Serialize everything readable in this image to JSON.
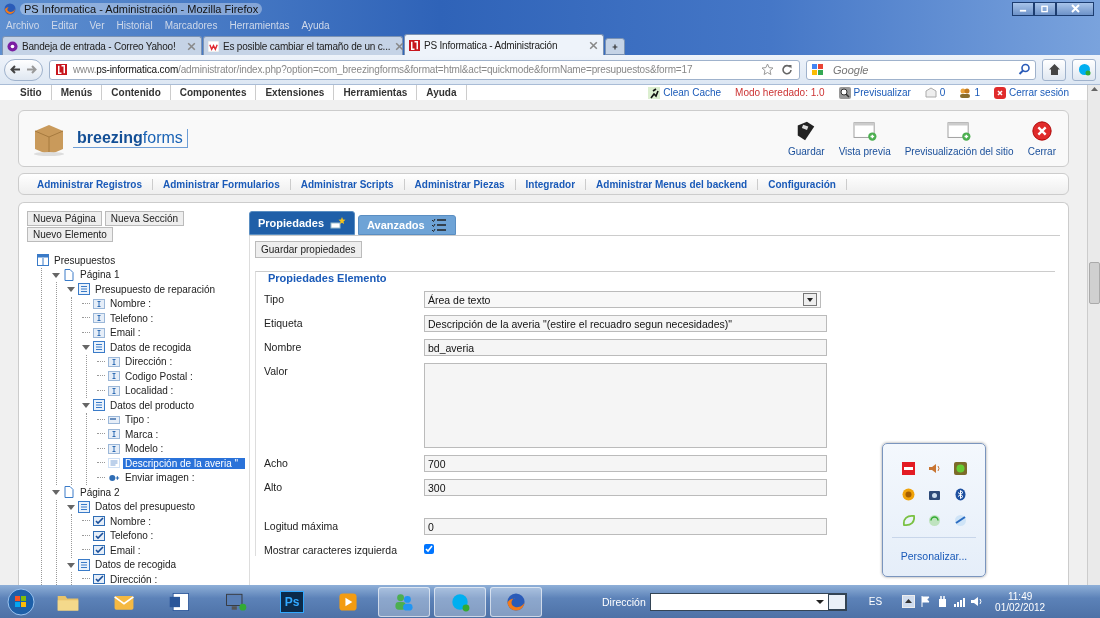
{
  "browser": {
    "title": "PS Informatica - Administración - Mozilla Firefox",
    "menu": [
      "Archivo",
      "Editar",
      "Ver",
      "Historial",
      "Marcadores",
      "Herramientas",
      "Ayuda"
    ],
    "tabs": [
      {
        "label": "Bandeja de entrada - Correo Yahoo!",
        "kind": "yahoo",
        "selected": false
      },
      {
        "label": "Es posible cambiar el tamaño de un c...",
        "kind": "w",
        "selected": false
      },
      {
        "label": "PS Informatica - Administración",
        "kind": "ps",
        "selected": true
      }
    ],
    "url": {
      "prefix": "www.",
      "domain": "ps-informatica.com",
      "path": "/administrator/index.php?option=com_breezingforms&format=html&act=quickmode&formName=presupuestos&form=17"
    },
    "search": {
      "placeholder": "Google"
    }
  },
  "admin_menu": [
    "Sitio",
    "Menús",
    "Contenido",
    "Componentes",
    "Extensiones",
    "Herramientas",
    "Ayuda"
  ],
  "status_links": [
    {
      "kind": "clean",
      "text": "Clean Cache"
    },
    {
      "kind": "mode",
      "text": "Modo heredado: 1.0"
    },
    {
      "kind": "preview",
      "text": "Previsualizar"
    },
    {
      "kind": "messages",
      "text": "0"
    },
    {
      "kind": "users",
      "text": "1"
    },
    {
      "kind": "logout",
      "text": "Cerrar sesión"
    }
  ],
  "logo": {
    "bold": "breezing",
    "rest": "forms"
  },
  "toolbar": [
    {
      "kind": "save",
      "label": "Guardar"
    },
    {
      "kind": "preview",
      "label": "Vista previa"
    },
    {
      "kind": "preview",
      "label": "Previsualización del sitio"
    },
    {
      "kind": "close",
      "label": "Cerrar"
    }
  ],
  "submenu": [
    "Administrar Registros",
    "Administrar Formularios",
    "Administrar Scripts",
    "Administrar Piezas",
    "Integrador",
    "Administrar Menus del backend",
    "Configuración"
  ],
  "editor_buttons": [
    "Nueva Página",
    "Nueva Sección",
    "Nuevo Elemento"
  ],
  "tree": {
    "label": "Presupuestos",
    "kind": "root",
    "selected": false,
    "children": [
      {
        "label": "Página 1",
        "kind": "page",
        "selected": false,
        "children": [
          {
            "label": "Presupuesto de reparación",
            "kind": "section",
            "selected": false,
            "children": [
              {
                "label": "Nombre :",
                "kind": "text",
                "selected": false
              },
              {
                "label": "Telefono :",
                "kind": "text",
                "selected": false
              },
              {
                "label": "Email :",
                "kind": "text",
                "selected": false
              },
              {
                "label": "Datos de recogida",
                "kind": "section",
                "selected": false,
                "children": [
                  {
                    "label": "Dirección :",
                    "kind": "text",
                    "selected": false
                  },
                  {
                    "label": "Codigo Postal :",
                    "kind": "text",
                    "selected": false
                  },
                  {
                    "label": "Localidad :",
                    "kind": "text",
                    "selected": false
                  }
                ]
              },
              {
                "label": "Datos del producto",
                "kind": "section",
                "selected": false,
                "children": [
                  {
                    "label": "Tipo :",
                    "kind": "select",
                    "selected": false
                  },
                  {
                    "label": "Marca :",
                    "kind": "text",
                    "selected": false
                  },
                  {
                    "label": "Modelo :",
                    "kind": "text",
                    "selected": false
                  },
                  {
                    "label": "Descripción de la averia \"",
                    "kind": "textarea",
                    "selected": true
                  },
                  {
                    "label": "Enviar imagen :",
                    "kind": "file",
                    "selected": false
                  }
                ]
              }
            ]
          }
        ]
      },
      {
        "label": "Página 2",
        "kind": "page",
        "selected": false,
        "children": [
          {
            "label": "Datos del presupuesto",
            "kind": "section",
            "selected": false,
            "children": [
              {
                "label": "Nombre :",
                "kind": "check",
                "selected": false
              },
              {
                "label": "Telefono :",
                "kind": "check",
                "selected": false
              },
              {
                "label": "Email :",
                "kind": "check",
                "selected": false
              }
            ]
          },
          {
            "label": "Datos de recogida",
            "kind": "section",
            "selected": false,
            "children": [
              {
                "label": "Dirección :",
                "kind": "check",
                "selected": false
              }
            ]
          }
        ]
      }
    ]
  },
  "panel_tabs": [
    {
      "label": "Propiedades",
      "kind": "star",
      "selected": true
    },
    {
      "label": "Avanzados",
      "kind": "list",
      "selected": false
    }
  ],
  "save_button": "Guardar propiedades",
  "legend": "Propiedades Elemento",
  "fields": [
    {
      "label": "Tipo",
      "kind": "select",
      "value": "Área de texto",
      "separated": false
    },
    {
      "label": "Etiqueta",
      "kind": "text",
      "value": "Descripción de la averia \"(estire el recuadro segun necesidades)\"",
      "separated": false
    },
    {
      "label": "Nombre",
      "kind": "text",
      "value": "bd_averia",
      "separated": false
    },
    {
      "label": "Valor",
      "kind": "textarea",
      "separated": false
    },
    {
      "label": "Acho",
      "kind": "text",
      "value": "700",
      "separated": false
    },
    {
      "label": "Alto",
      "kind": "text",
      "value": "300",
      "separated": false
    },
    {
      "label": "Logitud máxima",
      "kind": "text",
      "value": "0",
      "separated": true
    },
    {
      "label": "Mostrar caracteres izquierda",
      "kind": "checkbox",
      "checked": true,
      "separated": false
    }
  ],
  "tray_popup": {
    "link": "Personalizar..."
  },
  "taskbar": {
    "apps": [
      {
        "kind": "folder",
        "running": false
      },
      {
        "kind": "mail",
        "running": false
      },
      {
        "kind": "document",
        "running": false
      },
      {
        "kind": "computer",
        "running": false
      },
      {
        "kind": "ps",
        "label": "Ps",
        "running": false
      },
      {
        "kind": "media",
        "running": false
      },
      {
        "kind": "people",
        "running": true
      },
      {
        "kind": "skype",
        "running": true
      },
      {
        "kind": "firefox",
        "running": true
      }
    ],
    "address_label": "Dirección",
    "language": "ES",
    "time": "11:49",
    "date": "01/02/2012"
  }
}
